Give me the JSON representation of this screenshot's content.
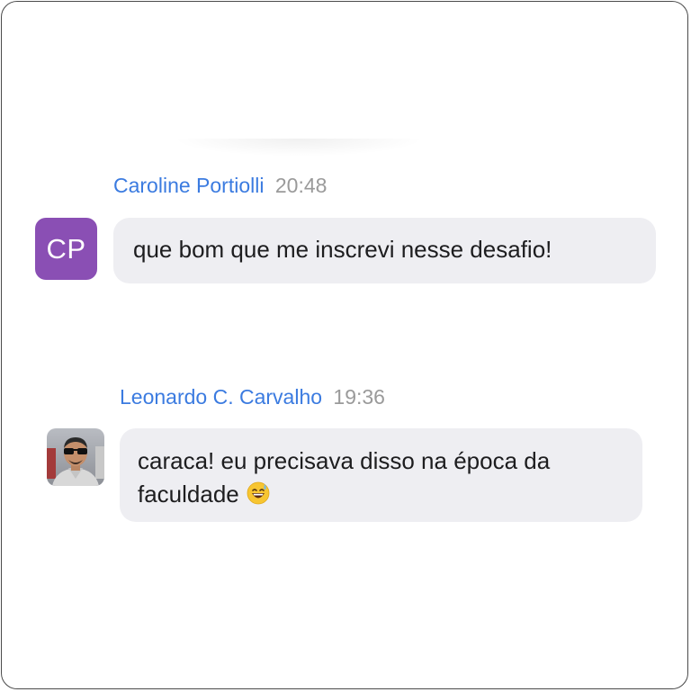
{
  "messages": [
    {
      "sender": "Caroline Portiolli",
      "time": "20:48",
      "avatar_initials": "CP",
      "avatar_color": "#8a4fb4",
      "text": "que bom que me inscrevi nesse desafio!"
    },
    {
      "sender": "Leonardo C. Carvalho",
      "time": "19:36",
      "avatar_icon": "user-photo-avatar",
      "text": "caraca! eu precisava disso na época da faculdade",
      "emoji_icon": "grinning-sweat-emoji"
    }
  ],
  "colors": {
    "sender_name": "#3b7be0",
    "timestamp": "#9a9a9a",
    "bubble_bg": "#eeeef2",
    "message_text": "#1d1d1f"
  }
}
